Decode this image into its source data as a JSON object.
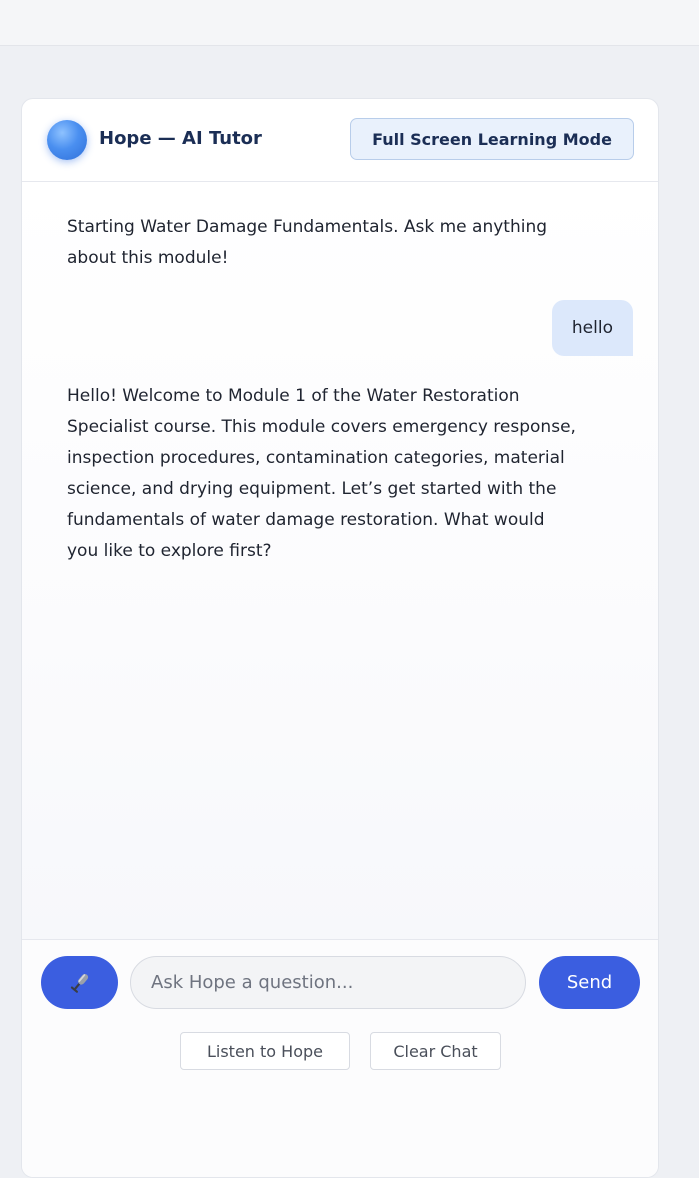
{
  "header": {
    "title": "Hope — AI Tutor",
    "fullscreen_label": "Full Screen Learning Mode"
  },
  "messages": [
    {
      "role": "bot",
      "text": "Starting Water Damage Fundamentals. Ask me anything about this module!"
    },
    {
      "role": "user",
      "text": "hello"
    },
    {
      "role": "bot",
      "text": "Hello! Welcome to Module 1 of the Water Restoration Specialist course. This module covers emergency response, inspection procedures, contamination categories, material science, and drying equipment. Let’s get started with the fundamentals of water damage restoration. What would you like to explore first?"
    }
  ],
  "composer": {
    "mic_icon": "microphone-icon",
    "input_placeholder": "Ask Hope a question...",
    "input_value": "",
    "send_label": "Send",
    "listen_label": "Listen to Hope",
    "clear_label": "Clear Chat"
  },
  "colors": {
    "accent": "#3b5ee0",
    "user_bubble": "#dce8fb",
    "title_text": "#1b2e55"
  }
}
